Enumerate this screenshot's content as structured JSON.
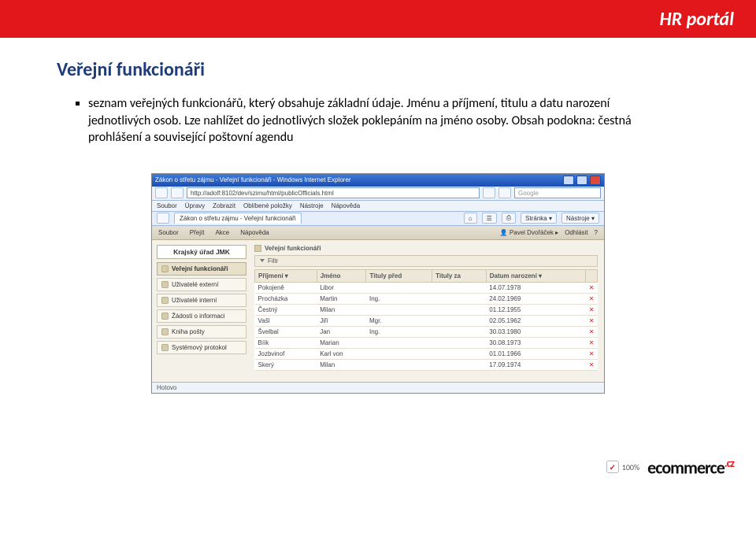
{
  "page": {
    "brand": "HR portál",
    "h1": "Veřejní funkcionáři",
    "bullet": "seznam veřejných funkcionářů, který obsahuje základní údaje. Jménu a příjmení, titulu a datu narození jednotlivých osob. Lze nahlížet do jednotlivých složek poklepáním na jméno osoby. Obsah podokna: čestná prohlášení a související poštovní agendu"
  },
  "shot": {
    "window_title": "Zákon o střetu zájmu - Veřejní funkcionáři - Windows Internet Explorer",
    "address": "http://adolf:8102/dev/szimu/html/publicOfficials.html",
    "search_hint": "Google",
    "ie_menu": [
      "Soubor",
      "Úpravy",
      "Zobrazit",
      "Oblíbené položky",
      "Nástroje",
      "Nápověda"
    ],
    "ie_tab": "Zákon o střetu zájmu - Veřejní funkcionáři",
    "ie_tools": [
      "Stránka ▾",
      "Nástroje ▾"
    ],
    "app_menu": [
      "Soubor",
      "Přejít",
      "Akce",
      "Nápověda"
    ],
    "user_area": [
      "Pavel Dvořáček",
      "Odhlásit"
    ],
    "sidebar_title": "Krajský úřad JMK",
    "sidebar_items": [
      "Veřejní funkcionáři",
      "Uživatelé externí",
      "Uživatelé interní",
      "Žádosti o informaci",
      "Kniha pošty",
      "Systémový protokol"
    ],
    "crumb": "Veřejní funkcionáři",
    "filter_label": "Filtr",
    "columns": [
      "Příjmení ▾",
      "Jméno",
      "Tituly před",
      "Tituly za",
      "Datum narození ▾",
      ""
    ],
    "rows": [
      {
        "surname": "Pokojeně",
        "first": "Libor",
        "tb": "",
        "ta": "",
        "dob": "14.07.1978"
      },
      {
        "surname": "Procházka",
        "first": "Martin",
        "tb": "Ing.",
        "ta": "",
        "dob": "24.02.1969"
      },
      {
        "surname": "Čestný",
        "first": "Milan",
        "tb": "",
        "ta": "",
        "dob": "01.12.1955"
      },
      {
        "surname": "Vašl",
        "first": "Jiří",
        "tb": "Mgr.",
        "ta": "",
        "dob": "02.05.1962"
      },
      {
        "surname": "Švelbal",
        "first": "Jan",
        "tb": "Ing.",
        "ta": "",
        "dob": "30.03.1980"
      },
      {
        "surname": "Bíík",
        "first": "Marian",
        "tb": "",
        "ta": "",
        "dob": "30.08.1973"
      },
      {
        "surname": "Jozbvinof",
        "first": "Karl von",
        "tb": "",
        "ta": "",
        "dob": "01.01.1966"
      },
      {
        "surname": "Skerý",
        "first": "Milan",
        "tb": "",
        "ta": "",
        "dob": "17.09.1974"
      }
    ],
    "status": "Hotovo"
  },
  "footer": {
    "badge_text": "100%",
    "logo_black": "ecommerce",
    "logo_cz": ".cz"
  }
}
